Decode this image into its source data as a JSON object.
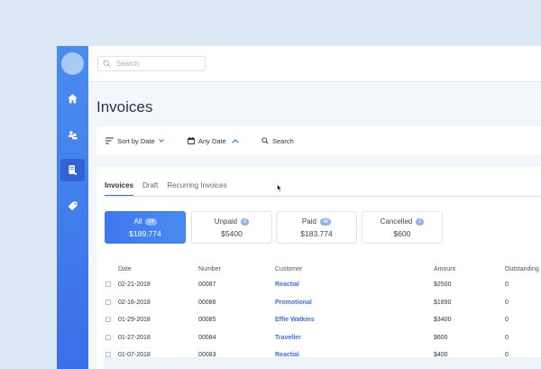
{
  "search": {
    "placeholder": "Search"
  },
  "page": {
    "title": "Invoices"
  },
  "filters": {
    "sort": "Sort by Date",
    "date": "Any Date",
    "search": "Search"
  },
  "tabs": [
    {
      "label": "Invoices",
      "active": true
    },
    {
      "label": "Draft",
      "active": false
    },
    {
      "label": "Recurring Invoices",
      "active": false
    }
  ],
  "stats": [
    {
      "label": "All",
      "count": "74",
      "amount": "$189,774",
      "active": true
    },
    {
      "label": "Unpaid",
      "count": "6",
      "amount": "$5400",
      "active": false
    },
    {
      "label": "Paid",
      "count": "48",
      "amount": "$183.774",
      "active": false
    },
    {
      "label": "Cancelled",
      "count": "2",
      "amount": "$600",
      "active": false
    }
  ],
  "table": {
    "columns": [
      "Date",
      "Number",
      "Customer",
      "Amount",
      "Outstanding"
    ],
    "rows": [
      {
        "date": "02-21-2018",
        "number": "00087",
        "customer": "Reactial",
        "amount": "$2500",
        "outstanding": "0"
      },
      {
        "date": "02-16-2018",
        "number": "00086",
        "customer": "Promotional",
        "amount": "$1890",
        "outstanding": "0"
      },
      {
        "date": "01-29-2018",
        "number": "00085",
        "customer": "Effie Watkins",
        "amount": "$3400",
        "outstanding": "0"
      },
      {
        "date": "01-27-2018",
        "number": "00084",
        "customer": "Traveller",
        "amount": "$600",
        "outstanding": "0"
      },
      {
        "date": "01-07-2018",
        "number": "00083",
        "customer": "Reactial",
        "amount": "$400",
        "outstanding": "0"
      }
    ]
  },
  "icons": {
    "nav": [
      "home-icon",
      "users-icon",
      "invoice-icon",
      "tag-icon"
    ],
    "accent": "#3a6fe8",
    "sidebar": "#4a8cf0"
  }
}
